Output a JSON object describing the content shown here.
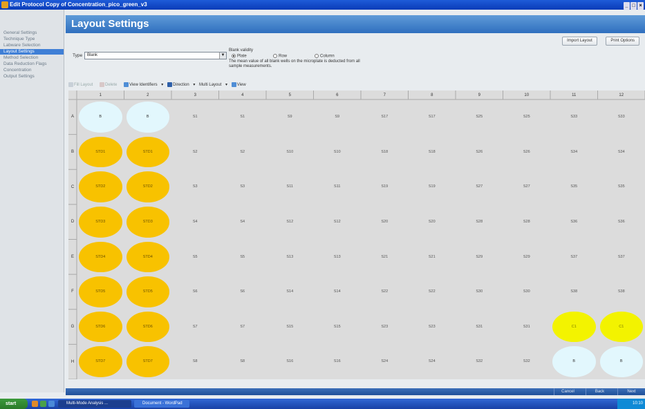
{
  "window": {
    "title": "Edit Protocol Copy of Concentration_pico_green_v3"
  },
  "sidebar": {
    "items": [
      {
        "label": "General Settings",
        "active": false
      },
      {
        "label": "Technique Type",
        "active": false
      },
      {
        "label": "Labware Selection",
        "active": false
      },
      {
        "label": "Layout Settings",
        "active": true
      },
      {
        "label": "Method Selection",
        "active": false
      },
      {
        "label": "Data Reduction Flags",
        "active": false
      },
      {
        "label": "Concentration",
        "active": false
      },
      {
        "label": "Output Settings",
        "active": false
      }
    ]
  },
  "header": {
    "title": "Layout Settings"
  },
  "top_buttons": {
    "import": "Import Layout",
    "print": "Print Options"
  },
  "settings": {
    "type_label": "Type",
    "type_value": "Blank",
    "blank_validity": {
      "label": "Blank validity",
      "options": [
        "Plate",
        "Row",
        "Column"
      ],
      "selected": "Plate",
      "description": "The mean value of all blank wells on the microplate is deducted from all sample measurements."
    }
  },
  "toolbar": {
    "fill_layout": "Fill Layout",
    "delete": "Delete",
    "view_identifiers": "View Identifiers",
    "direction": "Direction",
    "multi_layout": "Multi Layout",
    "view": "View"
  },
  "plate": {
    "columns": [
      "1",
      "2",
      "3",
      "4",
      "5",
      "6",
      "7",
      "8",
      "9",
      "10",
      "11",
      "12"
    ],
    "rows": [
      "A",
      "B",
      "C",
      "D",
      "E",
      "F",
      "G",
      "H"
    ],
    "wells": [
      [
        "B",
        "B",
        "S1",
        "S1",
        "S9",
        "S9",
        "S17",
        "S17",
        "S25",
        "S25",
        "S33",
        "S33"
      ],
      [
        "STD1",
        "STD1",
        "S2",
        "S2",
        "S10",
        "S10",
        "S18",
        "S18",
        "S26",
        "S26",
        "S34",
        "S34"
      ],
      [
        "STD2",
        "STD2",
        "S3",
        "S3",
        "S11",
        "S11",
        "S19",
        "S19",
        "S27",
        "S27",
        "S35",
        "S35"
      ],
      [
        "STD3",
        "STD3",
        "S4",
        "S4",
        "S12",
        "S12",
        "S20",
        "S20",
        "S28",
        "S28",
        "S36",
        "S36"
      ],
      [
        "STD4",
        "STD4",
        "S5",
        "S5",
        "S13",
        "S13",
        "S21",
        "S21",
        "S29",
        "S29",
        "S37",
        "S37"
      ],
      [
        "STD5",
        "STD5",
        "S6",
        "S6",
        "S14",
        "S14",
        "S22",
        "S22",
        "S30",
        "S30",
        "S38",
        "S38"
      ],
      [
        "STD6",
        "STD6",
        "S7",
        "S7",
        "S15",
        "S15",
        "S23",
        "S23",
        "S31",
        "S31",
        "C1",
        "C1"
      ],
      [
        "STD7",
        "STD7",
        "S8",
        "S8",
        "S16",
        "S16",
        "S24",
        "S24",
        "S32",
        "S32",
        "B",
        "B"
      ]
    ],
    "colors": {
      "std": "#f8c200",
      "blank": "#e2f7fd",
      "control": "#f3f300"
    }
  },
  "footer": {
    "cancel": "Cancel",
    "back": "Back",
    "next": "Next"
  },
  "taskbar": {
    "start": "start",
    "tasks": [
      "Multi-Mode Analysis ...",
      "Document - WordPad"
    ],
    "clock": "10:10"
  }
}
